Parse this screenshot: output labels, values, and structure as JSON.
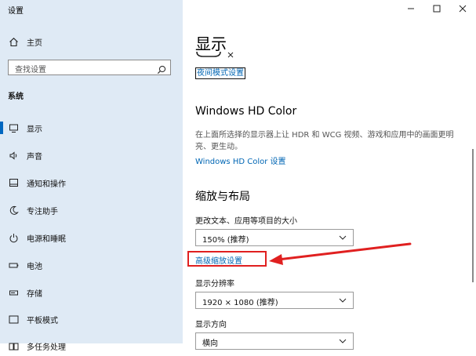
{
  "window": {
    "title": "设置"
  },
  "sidebar": {
    "home": "主页",
    "search_placeholder": "查找设置",
    "section": "系统",
    "items": [
      {
        "label": "显示",
        "icon": "monitor-icon",
        "selected": true
      },
      {
        "label": "声音",
        "icon": "speaker-icon"
      },
      {
        "label": "通知和操作",
        "icon": "notification-icon"
      },
      {
        "label": "专注助手",
        "icon": "moon-icon"
      },
      {
        "label": "电源和睡眠",
        "icon": "power-icon"
      },
      {
        "label": "电池",
        "icon": "battery-icon"
      },
      {
        "label": "存储",
        "icon": "storage-icon"
      },
      {
        "label": "平板模式",
        "icon": "tablet-icon"
      },
      {
        "label": "多任务处理",
        "icon": "multitask-icon"
      }
    ]
  },
  "main": {
    "title": "显示",
    "night_light_link": "夜间模式设置",
    "hd_color": {
      "heading": "Windows HD Color",
      "description": "在上面所选择的显示器上让 HDR 和 WCG 视频、游戏和应用中的画面更明亮、更生动。",
      "link": "Windows HD Color 设置"
    },
    "scale_layout": {
      "heading": "缩放与布局",
      "scale_label": "更改文本、应用等项目的大小",
      "scale_value": "150% (推荐)",
      "advanced_link": "高级缩放设置",
      "resolution_label": "显示分辨率",
      "resolution_value": "1920 × 1080 (推荐)",
      "orientation_label": "显示方向",
      "orientation_value": "横向"
    }
  },
  "annotation": {
    "color": "#e02020"
  },
  "colors": {
    "accent": "#0067c0",
    "link": "#0066b4",
    "sidebar_bg": "#dfeaf5"
  }
}
